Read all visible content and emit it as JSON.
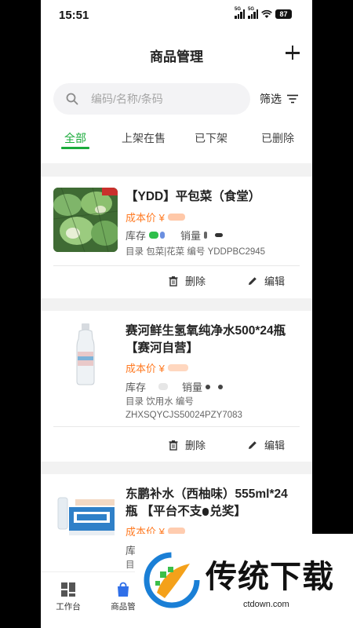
{
  "status": {
    "time": "15:51",
    "battery": "87",
    "signal1": "5G",
    "signal2": "5G"
  },
  "header": {
    "title": "商品管理"
  },
  "search": {
    "placeholder": "编码/名称/条码",
    "filter_label": "筛选"
  },
  "tabs": [
    {
      "label": "全部",
      "active": true
    },
    {
      "label": "上架在售",
      "active": false
    },
    {
      "label": "已下架",
      "active": false
    },
    {
      "label": "已删除",
      "active": false
    }
  ],
  "products": [
    {
      "title": "【YDD】平包菜（食堂）",
      "price_label": "成本价 ¥",
      "stock_label": "库存",
      "sales_label": "销量",
      "catalog_line": "目录 包菜|花菜   编号 YDDPBC2945",
      "delete_label": "删除",
      "edit_label": "编辑"
    },
    {
      "title_line1": "赛河鲜生氢氧纯净水500*24瓶",
      "title_line2": "【赛河自营】",
      "price_label": "成本价 ¥",
      "stock_label": "库存",
      "sales_label": "销量",
      "catalog_line": "目录 饮用水   编号",
      "code_line": "ZHXSQYCJS50024PZY7083",
      "delete_label": "删除",
      "edit_label": "编辑"
    },
    {
      "title_line1": "东鹏补水（西柚味）555ml*24",
      "title_line2": "瓶 【平台不支",
      "title_line2b": "兑奖】",
      "price_label": "成本价 ¥",
      "stock_label": "库",
      "catalog_label": "目"
    }
  ],
  "bottom_nav": [
    {
      "label": "工作台",
      "icon": "dashboard-icon"
    },
    {
      "label": "商品管",
      "icon": "shopping-bag-icon"
    }
  ],
  "watermark": {
    "text": "传统下载",
    "url": "ctdown.com"
  },
  "colors": {
    "accent": "#1aab3b",
    "price": "#ff7a22",
    "nav_active": "#2f6fe8"
  }
}
